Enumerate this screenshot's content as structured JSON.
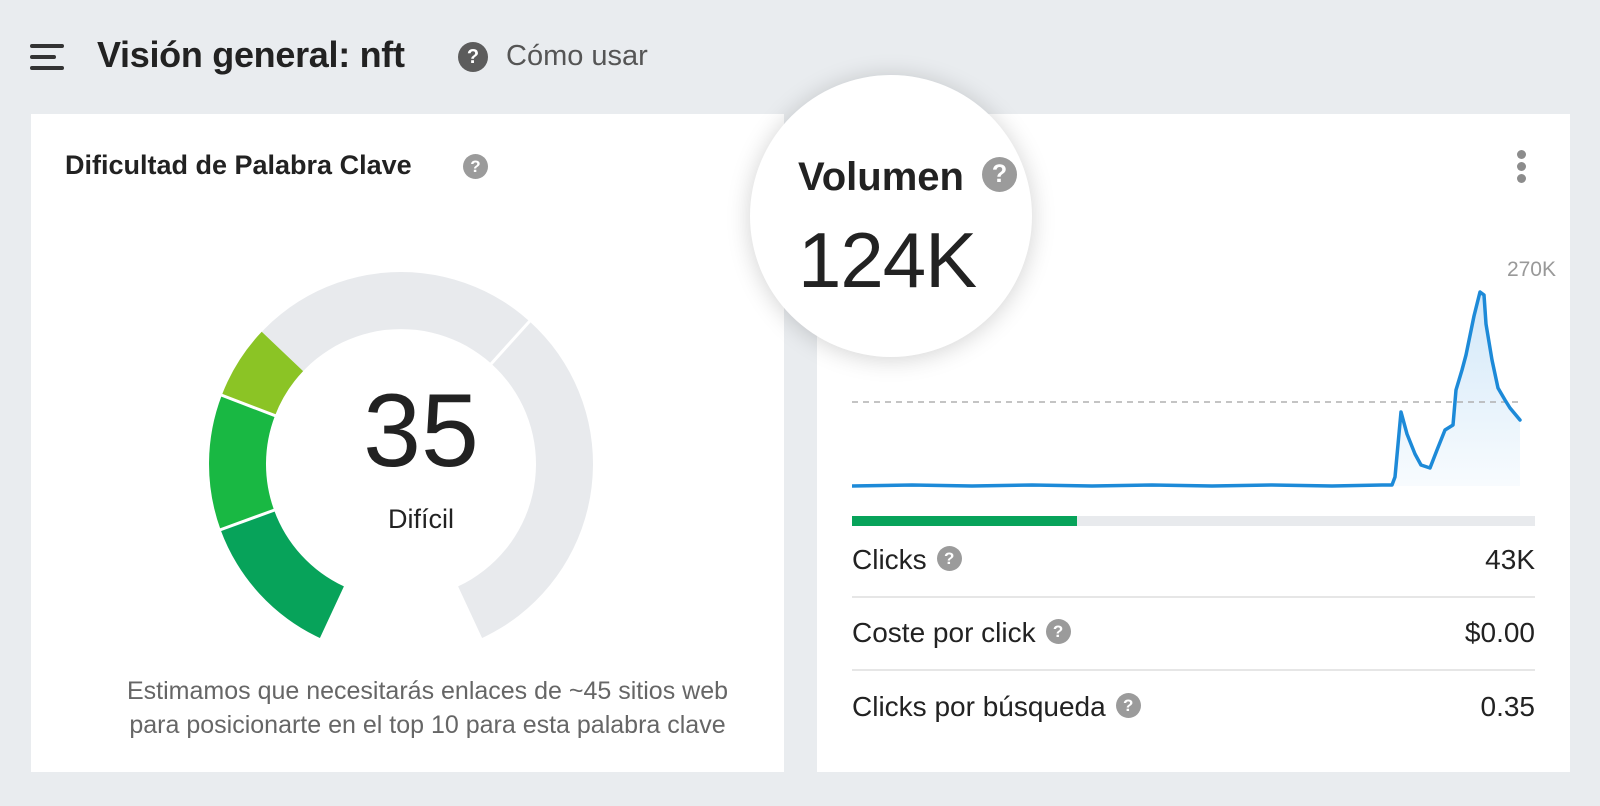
{
  "header": {
    "title": "Visión general: nft",
    "help_icon": "?",
    "how_to_label": "Cómo usar"
  },
  "difficulty": {
    "title": "Dificultad de Palabra Clave",
    "help_icon": "?",
    "score": "35",
    "score_fraction": 0.35,
    "rating": "Difícil",
    "description_line1": "Estimamos que necesitarás enlaces de ~45 sitios web",
    "description_line2": "para posicionarte en el top 10 para esta palabra clave",
    "colors": {
      "dark_green": "#07a35a",
      "green": "#19b843",
      "lime": "#8bc425",
      "track": "#e8eaed"
    }
  },
  "volume": {
    "title": "Volumen",
    "help_icon": "?",
    "value": "124K",
    "trend_max_label": "270K",
    "ctr_fraction": 0.33,
    "colors": {
      "line": "#1d8ad8",
      "fill": "#cfe6f8",
      "ctr": "#07a35a"
    }
  },
  "metrics": [
    {
      "label": "Clicks",
      "help_icon": "?",
      "value": "43K"
    },
    {
      "label": "Coste por click",
      "help_icon": "?",
      "value": "$0.00"
    },
    {
      "label": "Clicks por búsqueda",
      "help_icon": "?",
      "value": "0.35"
    }
  ]
}
